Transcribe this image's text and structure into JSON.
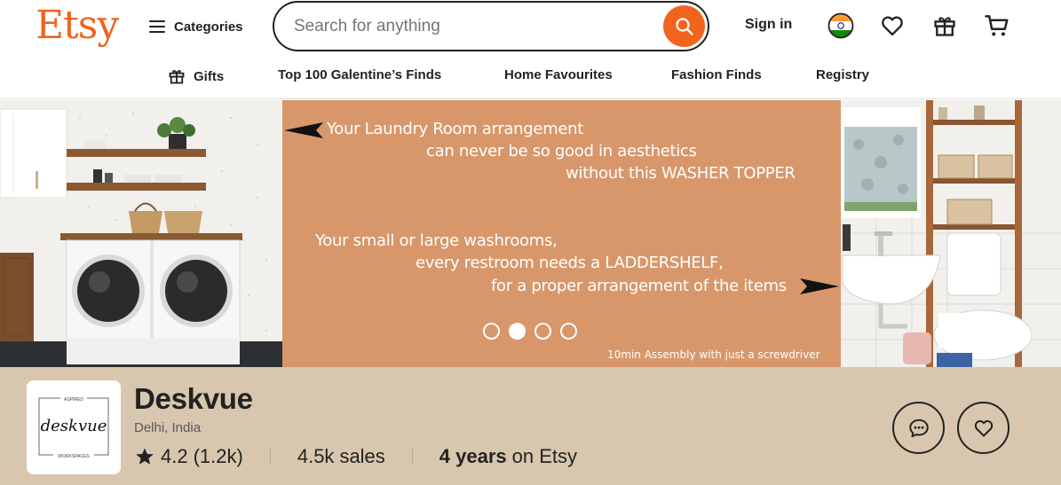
{
  "header": {
    "logo": "Etsy",
    "categories_label": "Categories",
    "search_placeholder": "Search for anything",
    "sign_in": "Sign in"
  },
  "subnav": {
    "items": [
      "Gifts",
      "Top 100 Galentine’s Finds",
      "Home Favourites",
      "Fashion Finds",
      "Registry"
    ]
  },
  "banner": {
    "lines": [
      "Your Laundry Room arrangement",
      "can never be so good in aesthetics",
      "without this WASHER TOPPER",
      "Your small or large washrooms,",
      "every restroom needs a LADDERSHELF,",
      "for a proper arrangement of the items"
    ],
    "caption": "10min Assembly with just a screwdriver",
    "slide_count": 4,
    "active_slide": 2
  },
  "shop": {
    "name": "Deskvue",
    "location": "Delhi, India",
    "rating": "4.2",
    "reviews": "(1.2k)",
    "sales_value": "4.5k",
    "sales_label": "sales",
    "years_value": "4 years",
    "years_label": "on Etsy",
    "logo_text": {
      "top": "ASPIRED",
      "main": "deskvue",
      "bottom": "WORKSPACES"
    }
  },
  "colors": {
    "brand": "#f1641e",
    "banner_bg": "#d7976b",
    "shopbar_bg": "#d8c7ae"
  },
  "icons": [
    "menu-icon",
    "search-icon",
    "india-flag-icon",
    "heart-icon",
    "gift-icon",
    "cart-icon",
    "message-icon",
    "favorite-shop-icon",
    "star-icon"
  ]
}
